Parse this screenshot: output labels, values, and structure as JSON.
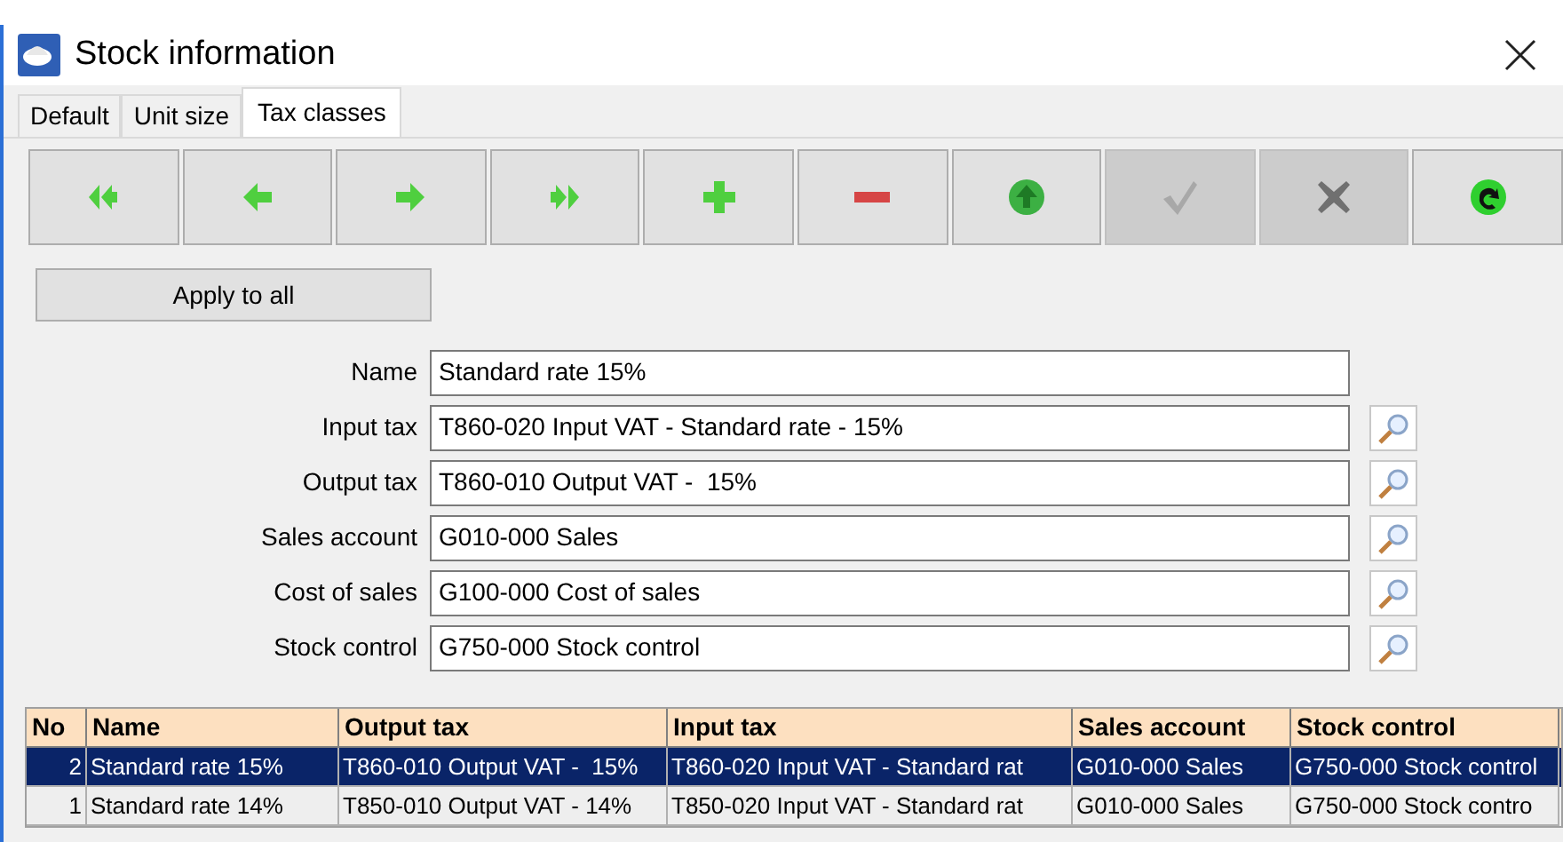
{
  "window": {
    "title": "Stock information"
  },
  "tabs": [
    {
      "label": "Default",
      "selected": false
    },
    {
      "label": "Unit size",
      "selected": false
    },
    {
      "label": "Tax classes",
      "selected": true
    }
  ],
  "toolbar": [
    {
      "kind": "first",
      "disabled": false
    },
    {
      "kind": "prev",
      "disabled": false
    },
    {
      "kind": "next",
      "disabled": false
    },
    {
      "kind": "last",
      "disabled": false
    },
    {
      "kind": "add",
      "disabled": false
    },
    {
      "kind": "remove",
      "disabled": false
    },
    {
      "kind": "up",
      "disabled": false
    },
    {
      "kind": "confirm",
      "disabled": true
    },
    {
      "kind": "cancel",
      "disabled": true
    },
    {
      "kind": "refresh",
      "disabled": false
    }
  ],
  "apply_button": "Apply to all",
  "fields": [
    {
      "label": "Name",
      "value": "Standard rate 15%",
      "lookup": false
    },
    {
      "label": "Input tax",
      "value": "T860-020 Input VAT - Standard rate - 15%",
      "lookup": true
    },
    {
      "label": "Output tax",
      "value": "T860-010 Output VAT -  15%",
      "lookup": true
    },
    {
      "label": "Sales account",
      "value": "G010-000 Sales",
      "lookup": true
    },
    {
      "label": "Cost of sales",
      "value": "G100-000 Cost of sales",
      "lookup": true
    },
    {
      "label": "Stock control",
      "value": "G750-000 Stock control",
      "lookup": true
    }
  ],
  "table": {
    "columns": [
      "No",
      "Name",
      "Output tax",
      "Input tax",
      "Sales account",
      "Stock control"
    ],
    "rows": [
      {
        "selected": true,
        "cells": [
          "2",
          "Standard rate 15%",
          "T860-010 Output VAT -  15%",
          "T860-020 Input VAT - Standard rat",
          "G010-000 Sales",
          "G750-000 Stock control"
        ]
      },
      {
        "selected": false,
        "cells": [
          "1",
          "Standard rate 14%",
          "T850-010 Output VAT - 14%",
          "T850-020 Input VAT - Standard rat",
          "G010-000 Sales",
          "G750-000 Stock contro"
        ]
      }
    ]
  }
}
